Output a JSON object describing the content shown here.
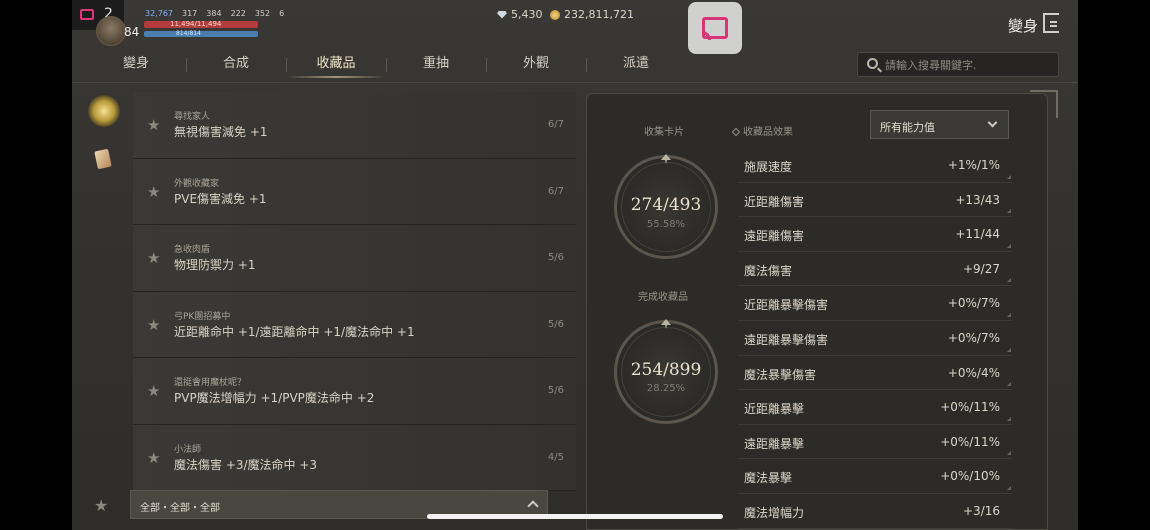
{
  "statusbar": {
    "notification_count": "2"
  },
  "player": {
    "level": "84",
    "stats": [
      "32,767",
      "317",
      "384",
      "222",
      "352",
      "6"
    ],
    "hp": "11,494/11,494",
    "mp": "814/814",
    "hp_fill": 1.0,
    "mp_fill": 1.0
  },
  "currency": {
    "diamonds": "5,430",
    "gold": "232,811,721"
  },
  "header": {
    "title": "變身"
  },
  "tabs": [
    {
      "label": "變身",
      "active": false
    },
    {
      "label": "合成",
      "active": false
    },
    {
      "label": "收藏品",
      "active": true
    },
    {
      "label": "重抽",
      "active": false
    },
    {
      "label": "外觀",
      "active": false
    },
    {
      "label": "派遣",
      "active": false
    }
  ],
  "search": {
    "placeholder": "請輸入搜尋關鍵字."
  },
  "collections": [
    {
      "title": "尋找家人",
      "effect": "無視傷害減免 +1",
      "count": "6/7"
    },
    {
      "title": "外觀收藏家",
      "effect": "PVE傷害減免 +1",
      "count": "6/7"
    },
    {
      "title": "急收肉盾",
      "effect": "物理防禦力 +1",
      "count": "5/6"
    },
    {
      "title": "弓PK團招募中",
      "effect": "近距離命中 +1/遠距離命中 +1/魔法命中 +1",
      "count": "5/6"
    },
    {
      "title": "還挺會用魔杖呢？",
      "effect": "PVP魔法增幅力 +1/PVP魔法命中 +2",
      "count": "5/6"
    },
    {
      "title": "小法師",
      "effect": "魔法傷害 +3/魔法命中 +3",
      "count": "4/5"
    }
  ],
  "filter": {
    "label": "全部・全部・全部"
  },
  "summary": {
    "cards_label": "收集卡片",
    "cards_value": "274/493",
    "cards_pct": "55.58%",
    "complete_label": "完成收藏品",
    "complete_value": "254/899",
    "complete_pct": "28.25%",
    "effects_label": "收藏品效果"
  },
  "effects_dropdown": {
    "selected": "所有能力值"
  },
  "effects": [
    {
      "name": "施展速度",
      "value": "+1%/1%"
    },
    {
      "name": "近距離傷害",
      "value": "+13/43"
    },
    {
      "name": "遠距離傷害",
      "value": "+11/44"
    },
    {
      "name": "魔法傷害",
      "value": "+9/27"
    },
    {
      "name": "近距離暴擊傷害",
      "value": "+0%/7%"
    },
    {
      "name": "遠距離暴擊傷害",
      "value": "+0%/7%"
    },
    {
      "name": "魔法暴擊傷害",
      "value": "+0%/4%"
    },
    {
      "name": "近距離暴擊",
      "value": "+0%/11%"
    },
    {
      "name": "遠距離暴擊",
      "value": "+0%/11%"
    },
    {
      "name": "魔法暴擊",
      "value": "+0%/10%"
    },
    {
      "name": "魔法增幅力",
      "value": "+3/16"
    }
  ]
}
